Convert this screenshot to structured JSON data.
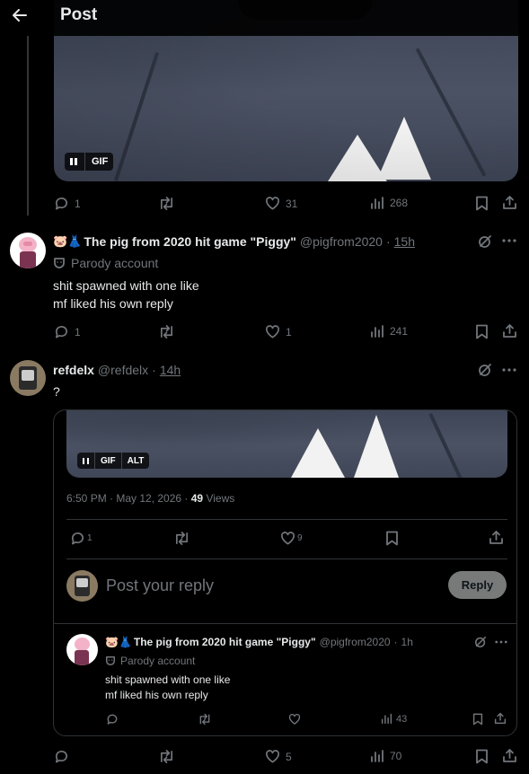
{
  "header": {
    "title": "Post"
  },
  "media_top": {
    "badge": "GIF"
  },
  "main_actions": {
    "replies": "1",
    "likes": "31",
    "views": "268"
  },
  "reply1": {
    "emoji": "🐷👗",
    "name": "The pig from 2020 hit game \"Piggy\"",
    "handle": "@pigfrom2020",
    "sep": "·",
    "time": "15h",
    "label": "Parody account",
    "lines": [
      "shit spawned with one like",
      "mf liked his own reply"
    ],
    "actions": {
      "replies": "1",
      "likes": "1",
      "views": "241"
    }
  },
  "reply2": {
    "name": "refdelx",
    "handle": "@refdelx",
    "sep": "·",
    "time": "14h",
    "text": "?",
    "quote": {
      "badges": [
        "GIF",
        "ALT"
      ],
      "timestamp": "6:50 PM · May 12, 2026 ·",
      "views_count": "49",
      "views_label": "Views",
      "actions": {
        "replies": "1",
        "likes": "9"
      },
      "compose_placeholder": "Post your reply",
      "reply_button": "Reply",
      "nested": {
        "emoji": "🐷👗",
        "name": "The pig from 2020 hit game \"Piggy\"",
        "handle": "@pigfrom2020",
        "sep": "·",
        "time": "1h",
        "label": "Parody account",
        "lines": [
          "shit spawned with one like",
          "mf liked his own reply"
        ],
        "views": "43"
      }
    },
    "actions": {
      "likes": "5",
      "views": "70"
    }
  }
}
